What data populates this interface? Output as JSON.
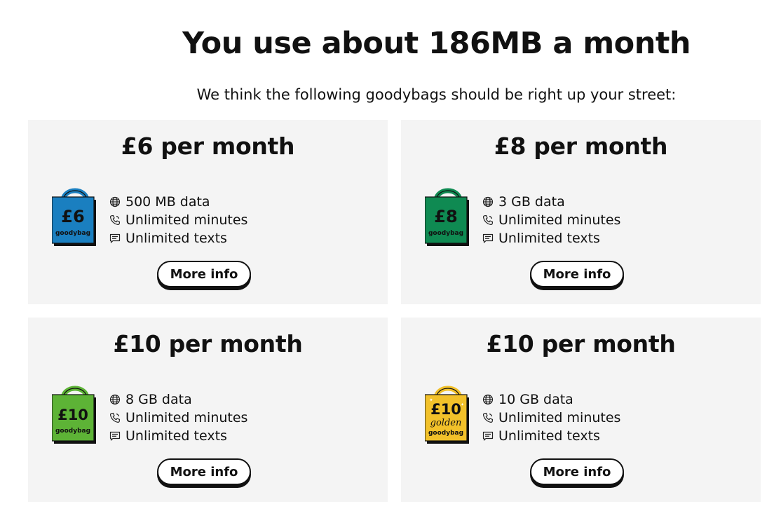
{
  "headline": "You use about 186MB a month",
  "subtitle": "We think the following goodybags should be right up your street:",
  "plans": [
    {
      "price": "£6 per month",
      "bag_amount": "£6",
      "bag_brand": "goodybag",
      "bag_golden": "",
      "bag_color": "#1a7fc0",
      "data": "500 MB data",
      "minutes": "Unlimited minutes",
      "texts": "Unlimited texts",
      "button": "More info"
    },
    {
      "price": "£8 per month",
      "bag_amount": "£8",
      "bag_brand": "goodybag",
      "bag_golden": "",
      "bag_color": "#0f8a52",
      "data": "3 GB data",
      "minutes": "Unlimited minutes",
      "texts": "Unlimited texts",
      "button": "More info"
    },
    {
      "price": "£10 per month",
      "bag_amount": "£10",
      "bag_brand": "goodybag",
      "bag_golden": "",
      "bag_color": "#5db336",
      "data": "8 GB data",
      "minutes": "Unlimited minutes",
      "texts": "Unlimited texts",
      "button": "More info"
    },
    {
      "price": "£10 per month",
      "bag_amount": "£10",
      "bag_brand": "goodybag",
      "bag_golden": "golden",
      "bag_color": "#f2c12a",
      "data": "10 GB data",
      "minutes": "Unlimited minutes",
      "texts": "Unlimited texts",
      "button": "More info"
    }
  ],
  "icons": {
    "data": "globe-icon",
    "minutes": "phone-icon",
    "texts": "message-icon"
  }
}
